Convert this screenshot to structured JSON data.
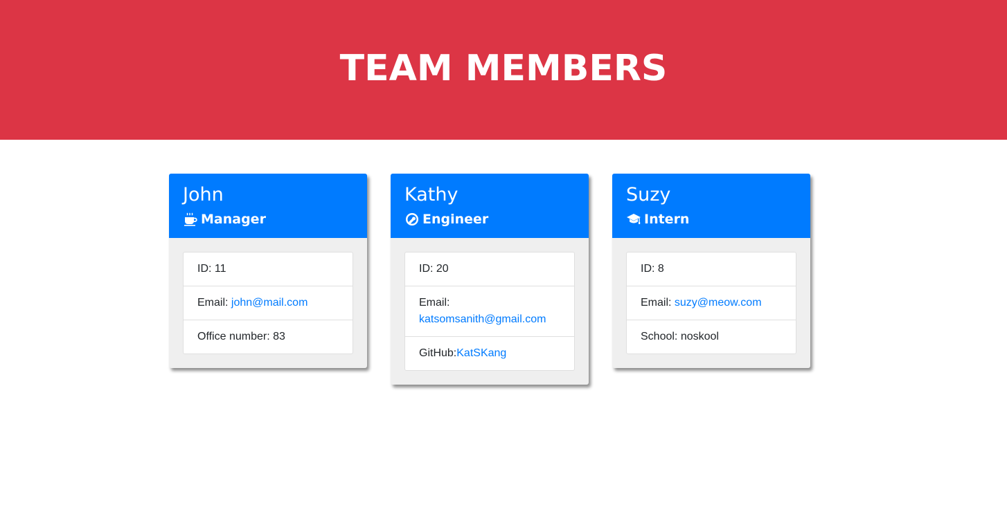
{
  "header": {
    "title": "TEAM MEMBERS",
    "background_color": "#dc3545"
  },
  "colors": {
    "card_header": "#007bff",
    "link": "#007bff",
    "card_body": "#efefef"
  },
  "members": [
    {
      "name": "John",
      "role": "Manager",
      "icon": "coffee-icon",
      "id_label": "ID: ",
      "id": "11",
      "email_label": "Email: ",
      "email": "john@mail.com",
      "extra_label": "Office number: ",
      "extra_value": "83"
    },
    {
      "name": "Kathy",
      "role": "Engineer",
      "icon": "engineer-icon",
      "id_label": "ID: ",
      "id": "20",
      "email_label": "Email:",
      "email": "katsomsanith@gmail.com",
      "extra_label": "GitHub:",
      "extra_value": "KatSKang"
    },
    {
      "name": "Suzy",
      "role": "Intern",
      "icon": "graduation-cap-icon",
      "id_label": "ID: ",
      "id": "8",
      "email_label": "Email: ",
      "email": "suzy@meow.com",
      "extra_label": "School: ",
      "extra_value": "noskool"
    }
  ]
}
